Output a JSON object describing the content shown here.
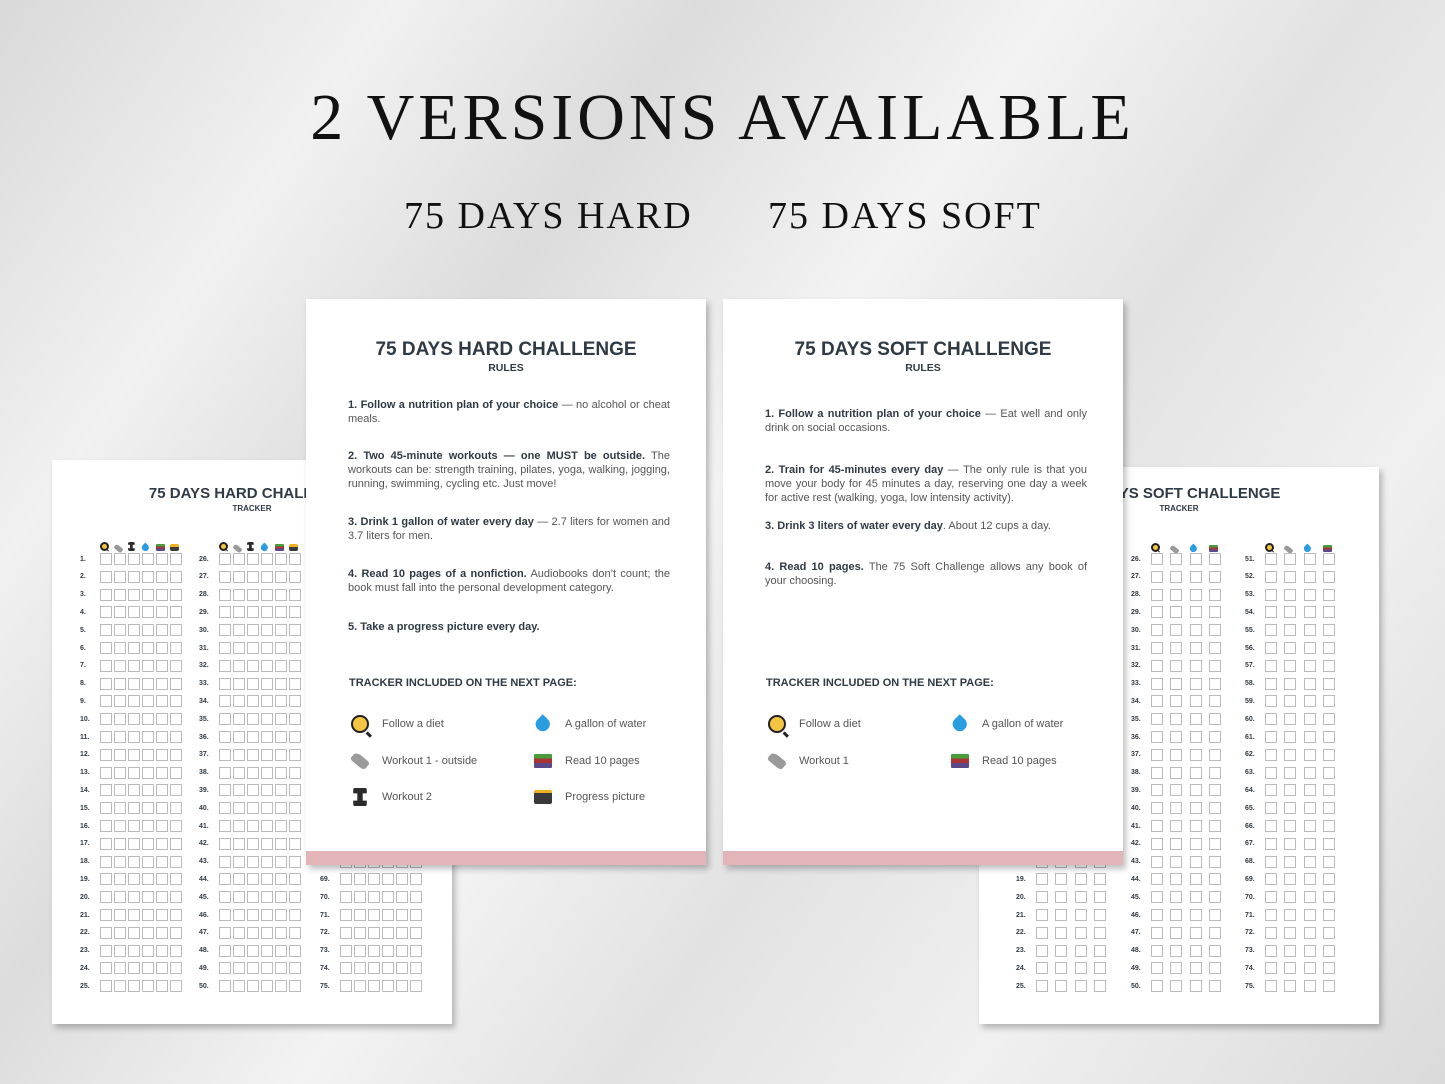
{
  "headline": "2 VERSIONS AVAILABLE",
  "versions": [
    "75 DAYS HARD",
    "75 DAYS SOFT"
  ],
  "hard_tracker": {
    "title": "75 DAYS HARD CHALLENGE",
    "subtitle": "TRACKER",
    "icons": [
      "magnifier-pan-icon",
      "sneaker-icon",
      "dumbbell-icon",
      "water-drop-icon",
      "books-icon",
      "camera-icon"
    ],
    "days_total": 75
  },
  "soft_tracker": {
    "title": "75 DAYS SOFT CHALLENGE",
    "subtitle": "TRACKER",
    "icons": [
      "magnifier-pan-icon",
      "sneaker-icon",
      "water-drop-icon",
      "books-icon"
    ],
    "days_total": 75
  },
  "hard_rules": {
    "title": "75 DAYS HARD CHALLENGE",
    "subtitle": "RULES",
    "rules": [
      {
        "bold": "1. Follow a nutrition plan of your choice",
        "text": " — no alcohol or cheat meals."
      },
      {
        "bold": "2. Two 45-minute workouts — one MUST be outside.",
        "text": " The workouts can be: strength training, pilates, yoga, walking, jogging, running, swimming, cycling etc. Just move!"
      },
      {
        "bold": "3. Drink 1 gallon of water every day",
        "text": " — 2.7 liters for women and 3.7 liters for men."
      },
      {
        "bold": "4. Read 10 pages of a nonfiction.",
        "text": " Audiobooks don’t count; the book must fall into the personal development category."
      },
      {
        "bold": "5. Take a progress picture every day.",
        "text": ""
      }
    ],
    "tracker_heading": "TRACKER INCLUDED ON THE NEXT PAGE:",
    "legend": [
      {
        "icon": "magnifier-pan-icon",
        "label": "Follow a diet"
      },
      {
        "icon": "sneaker-icon",
        "label": "Workout 1 - outside"
      },
      {
        "icon": "dumbbell-icon",
        "label": "Workout 2"
      },
      {
        "icon": "water-drop-icon",
        "label": "A gallon of water"
      },
      {
        "icon": "books-icon",
        "label": "Read 10 pages"
      },
      {
        "icon": "camera-icon",
        "label": "Progress picture"
      }
    ]
  },
  "soft_rules": {
    "title": "75 DAYS SOFT CHALLENGE",
    "subtitle": "RULES",
    "rules": [
      {
        "bold": "1. Follow a nutrition plan of your choice",
        "text": " — Eat well and only drink on social occasions."
      },
      {
        "bold": "2. Train for 45-minutes every day",
        "text": " — The only rule is that you move your body for 45 minutes a day, reserving one day a week for active rest (walking, yoga, low intensity activity)."
      },
      {
        "bold": "3. Drink 3 liters of water every day",
        "text": ". About 12 cups a day."
      },
      {
        "bold": "4. Read 10 pages.",
        "text": " The 75 Soft Challenge allows any book of your choosing."
      }
    ],
    "tracker_heading": "TRACKER INCLUDED ON THE NEXT PAGE:",
    "legend": [
      {
        "icon": "magnifier-pan-icon",
        "label": "Follow a diet"
      },
      {
        "icon": "sneaker-icon",
        "label": "Workout 1"
      },
      {
        "icon": "water-drop-icon",
        "label": "A gallon of water"
      },
      {
        "icon": "books-icon",
        "label": "Read 10 pages"
      }
    ]
  },
  "colors": {
    "accent_bar": "#e3b4b8",
    "heading": "#2f3a44",
    "water": "#2a9de0"
  }
}
